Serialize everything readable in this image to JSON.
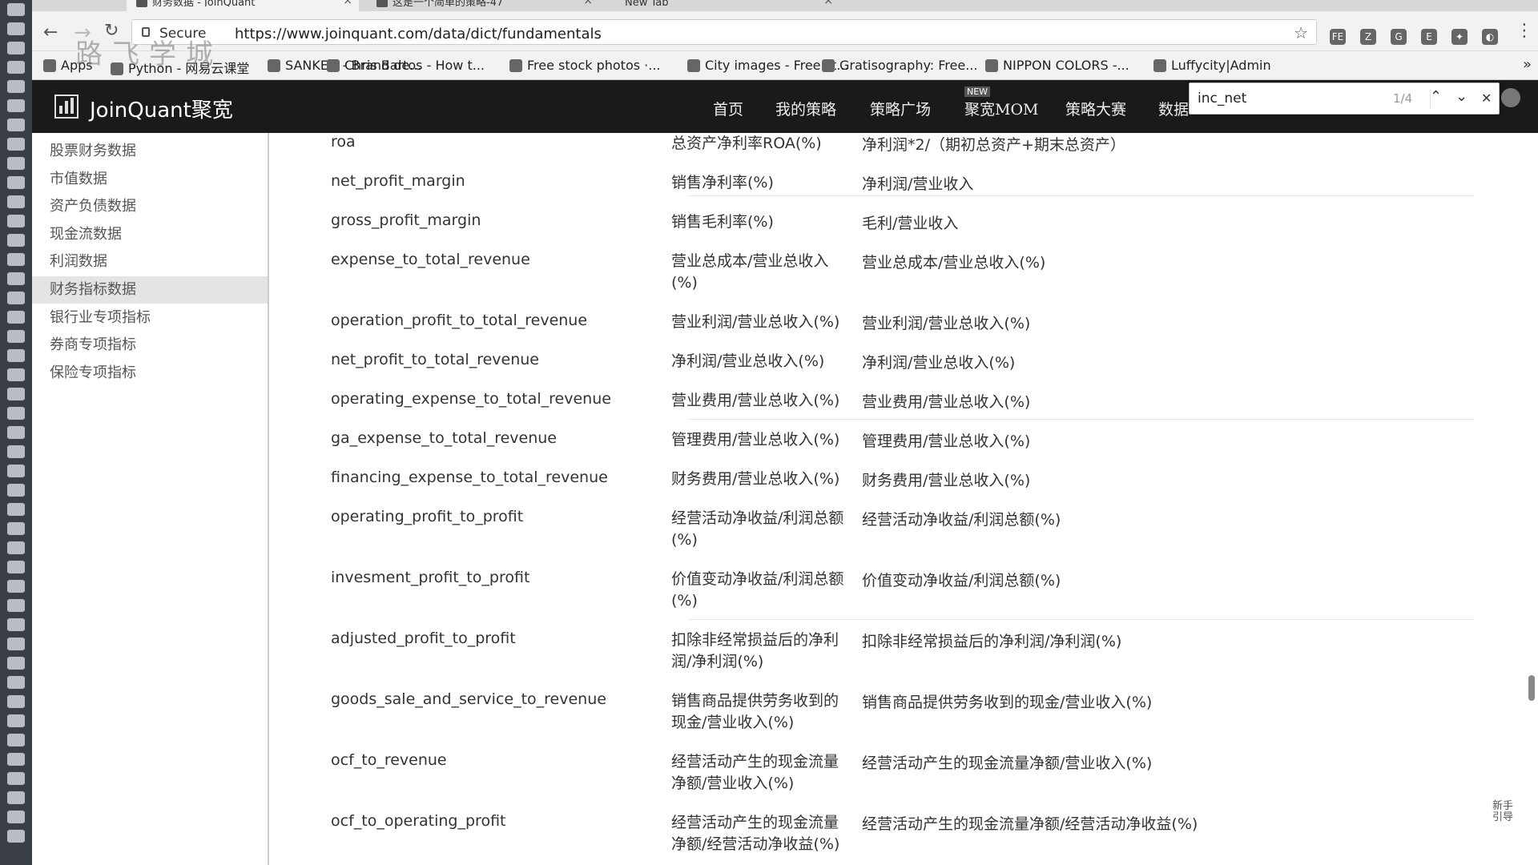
{
  "browser": {
    "tabs": [
      {
        "title": "财务数据 - JoinQuant"
      },
      {
        "title": "这是一个简单的策略-47"
      },
      {
        "title": "New Tab"
      }
    ],
    "secure_label": "Secure",
    "url": "https://www.joinquant.com/data/dict/fundamentals",
    "extensions": [
      "FE",
      "Z",
      "G",
      "E",
      "✦",
      "◐"
    ],
    "bookmarks": [
      "Apps",
      "Python - 网易云课堂",
      "SANKEO - Brand de...",
      "Chris Bartos - How t...",
      "Free stock photos ·...",
      "City images - Free st...",
      "Gratisography: Free...",
      "NIPPON COLORS -...",
      "Luffycity|Admin"
    ],
    "watermark": "路飞学城"
  },
  "site": {
    "logo": "JoinQuant聚宽",
    "nav": [
      "首页",
      "我的策略",
      "策略广场",
      "聚宽MOM",
      "策略大赛",
      "数据"
    ],
    "new_badge": "NEW"
  },
  "find_bar": {
    "query": "inc_net",
    "count": "1/4"
  },
  "sidebar": {
    "items": [
      {
        "label": "股票财务数据",
        "active": false
      },
      {
        "label": "市值数据",
        "active": false
      },
      {
        "label": "资产负债数据",
        "active": false
      },
      {
        "label": "现金流数据",
        "active": false
      },
      {
        "label": "利润数据",
        "active": false
      },
      {
        "label": "财务指标数据",
        "active": true
      },
      {
        "label": "银行业专项指标",
        "active": false
      },
      {
        "label": "券商专项指标",
        "active": false
      },
      {
        "label": "保险专项指标",
        "active": false
      }
    ]
  },
  "rows": [
    {
      "name": "roa",
      "cn": "总资产净利率ROA(%)",
      "formula": "净利润*2/（期初总资产+期末总资产）"
    },
    {
      "name": "net_profit_margin",
      "cn": "销售净利率(%)",
      "formula": "净利润/营业收入"
    },
    {
      "name": "gross_profit_margin",
      "cn": "销售毛利率(%)",
      "formula": "毛利/营业收入"
    },
    {
      "name": "expense_to_total_revenue",
      "cn": "营业总成本/营业总收入(%)",
      "formula": "营业总成本/营业总收入(%)"
    },
    {
      "name": "operation_profit_to_total_revenue",
      "cn": "营业利润/营业总收入(%)",
      "formula": "营业利润/营业总收入(%)"
    },
    {
      "name": "net_profit_to_total_revenue",
      "cn": "净利润/营业总收入(%)",
      "formula": "净利润/营业总收入(%)"
    },
    {
      "name": "operating_expense_to_total_revenue",
      "cn": "营业费用/营业总收入(%)",
      "formula": "营业费用/营业总收入(%)"
    },
    {
      "name": "ga_expense_to_total_revenue",
      "cn": "管理费用/营业总收入(%)",
      "formula": "管理费用/营业总收入(%)"
    },
    {
      "name": "financing_expense_to_total_revenue",
      "cn": "财务费用/营业总收入(%)",
      "formula": "财务费用/营业总收入(%)"
    },
    {
      "name": "operating_profit_to_profit",
      "cn": "经营活动净收益/利润总额(%)",
      "formula": "经营活动净收益/利润总额(%)"
    },
    {
      "name": "invesment_profit_to_profit",
      "cn": "价值变动净收益/利润总额(%)",
      "formula": "价值变动净收益/利润总额(%)"
    },
    {
      "name": "adjusted_profit_to_profit",
      "cn": "扣除非经常损益后的净利润/净利润(%)",
      "formula": "扣除非经常损益后的净利润/净利润(%)"
    },
    {
      "name": "goods_sale_and_service_to_revenue",
      "cn": "销售商品提供劳务收到的现金/营业收入(%)",
      "formula": "销售商品提供劳务收到的现金/营业收入(%)"
    },
    {
      "name": "ocf_to_revenue",
      "cn": "经营活动产生的现金流量净额/营业收入(%)",
      "formula": "经营活动产生的现金流量净额/营业收入(%)"
    },
    {
      "name": "ocf_to_operating_profit",
      "cn": "经营活动产生的现金流量净额/经营活动净收益(%)",
      "formula": "经营活动产生的现金流量净额/经营活动净收益(%)"
    }
  ],
  "side_note": "新手引导"
}
